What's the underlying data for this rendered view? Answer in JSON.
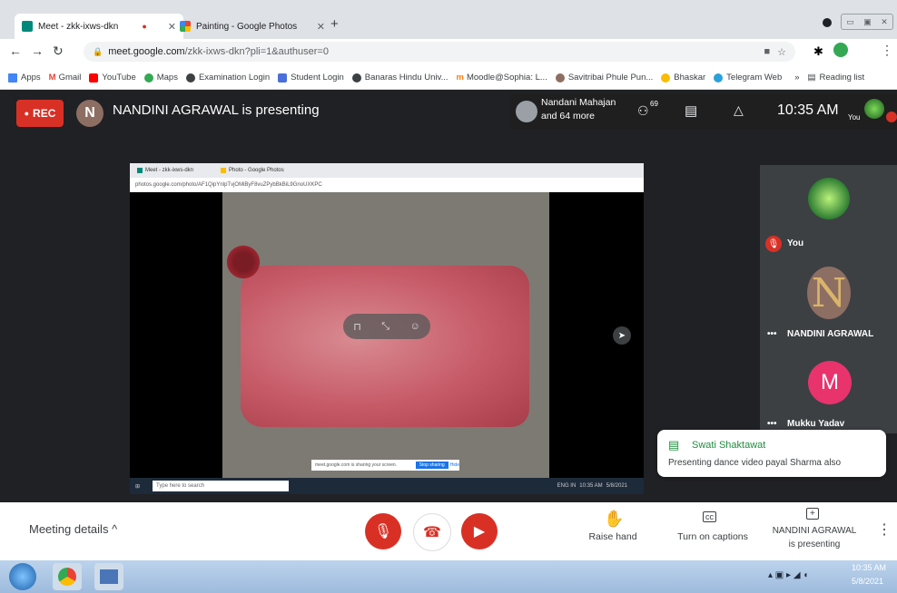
{
  "browser": {
    "tabs": [
      {
        "title": "Meet - zkk-ixws-dkn",
        "active": true
      },
      {
        "title": "Painting - Google Photos",
        "active": false
      }
    ],
    "new_tab": "+",
    "url_host": "meet.google.com",
    "url_path": "/zkk-ixws-dkn?pli=1&authuser=0",
    "bookmarks": [
      "Apps",
      "Gmail",
      "YouTube",
      "Maps",
      "Examination Login",
      "Student Login",
      "Banaras Hindu Univ...",
      "Moodle@Sophia: L...",
      "Savitribai Phule Pun...",
      "Bhaskar",
      "Telegram Web"
    ],
    "bookmarks_more": "»",
    "reading_list": "Reading list"
  },
  "meet": {
    "rec_label": "REC",
    "presenter_initial": "N",
    "presenting_text": "NANDINI AGRAWAL is presenting",
    "participants_line1": "Nandani Mahajan",
    "participants_line2": "and 64 more",
    "people_count": "69",
    "clock": "10:35 AM",
    "you_label": "You",
    "colors": {
      "rec": "#d93025",
      "end_call": "#d93025",
      "avatar_m": "#e8336d"
    }
  },
  "shared_screen": {
    "mini_tab1": "Meet - zkk-ixws-dkn",
    "mini_tab2": "Photo - Google Photos",
    "mini_url": "photos.google.com/photo/AF1QipYnlpTvjOMiByF8vuZPybBkBiL9GnoUXKPC",
    "share_text": "meet.google.com is sharing your screen.",
    "stop_sharing": "Stop sharing",
    "hide": "Hide",
    "search_placeholder": "Type here to search",
    "mini_tray_lang": "ENG IN",
    "mini_tray_time": "10:35 AM",
    "mini_tray_date": "5/8/2021"
  },
  "participants": [
    {
      "name": "You",
      "muted": true
    },
    {
      "name": "NANDINI AGRAWAL",
      "initial": "N"
    },
    {
      "name": "Mukku Yadav",
      "initial": "M"
    }
  ],
  "chat_toast": {
    "sender": "Swati Shaktawat",
    "message": "Presenting dance video payal Sharma also"
  },
  "bottom": {
    "meeting_details": "Meeting details",
    "raise_hand": "Raise hand",
    "captions": "Turn on captions",
    "presenting_line1": "NANDINI AGRAWAL",
    "presenting_line2": "is presenting"
  },
  "taskbar": {
    "time": "10:35 AM",
    "date": "5/8/2021"
  }
}
